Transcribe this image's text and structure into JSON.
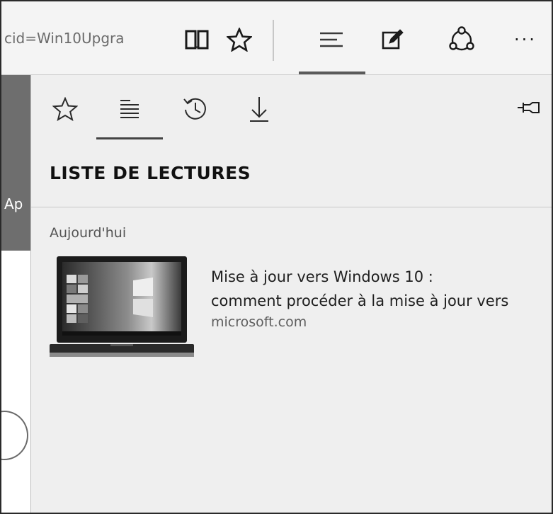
{
  "toolbar": {
    "url_fragment": "cid=Win10Upgra",
    "icons": [
      "reading-view-icon",
      "favorite-star-icon",
      "hub-icon",
      "web-note-icon",
      "share-icon",
      "more-icon"
    ],
    "more_label": "···"
  },
  "page": {
    "edge_text": "Ap"
  },
  "hub": {
    "tabs": [
      "favorites-icon",
      "reading-list-icon",
      "history-icon",
      "downloads-icon"
    ],
    "active_tab": "reading-list-icon",
    "pin_icon": "pin-icon",
    "heading": "LISTE DE LECTURES",
    "section": "Aujourd'hui",
    "items": [
      {
        "title_line1": "Mise à jour vers Windows 10 :",
        "title_line2": "comment procéder à la mise à jour vers",
        "source": "microsoft.com"
      }
    ]
  }
}
